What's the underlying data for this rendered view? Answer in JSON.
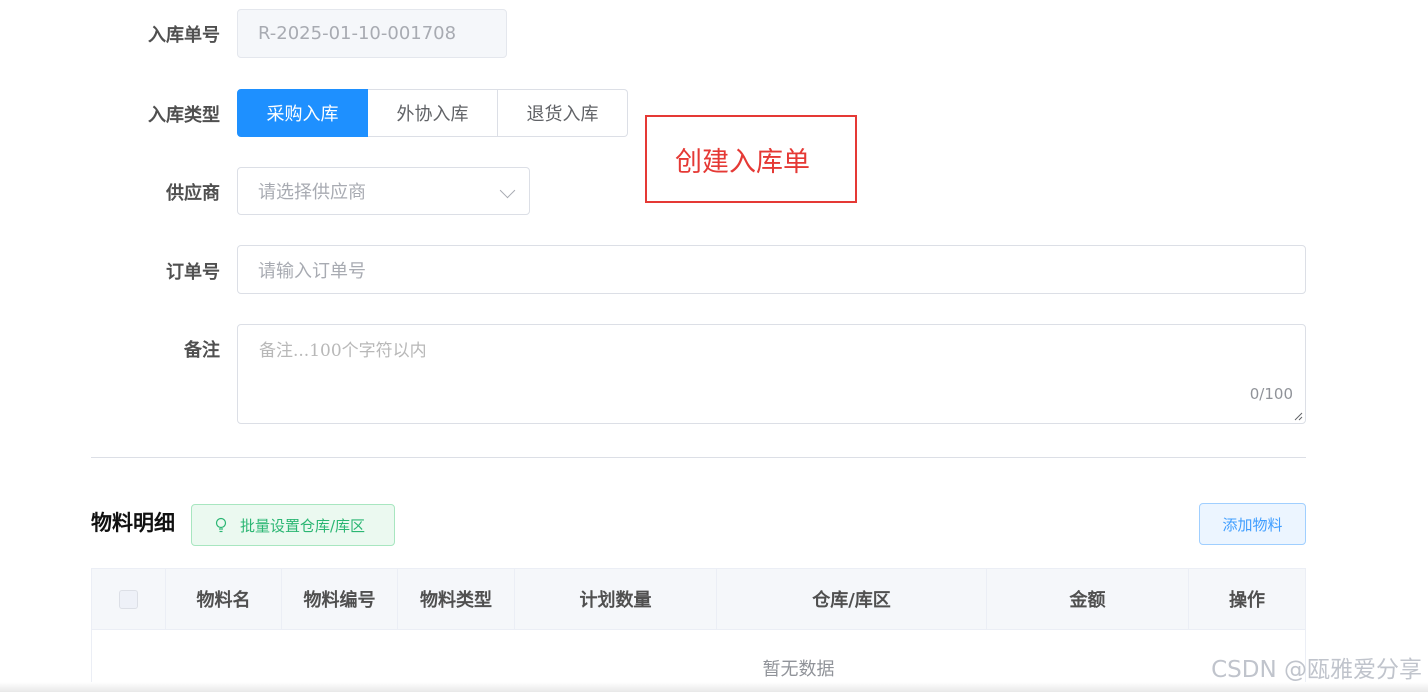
{
  "form": {
    "order_no": {
      "label": "入库单号",
      "value": "R-2025-01-10-001708"
    },
    "type": {
      "label": "入库类型",
      "options": [
        "采购入库",
        "外协入库",
        "退货入库"
      ],
      "selected": "采购入库"
    },
    "supplier": {
      "label": "供应商",
      "placeholder": "请选择供应商"
    },
    "purchase_order": {
      "label": "订单号",
      "placeholder": "请输入订单号"
    },
    "remark": {
      "label": "备注",
      "placeholder": "备注...100个字符以内",
      "count": "0/100"
    }
  },
  "annotation": {
    "text": "创建入库单",
    "color": "#e53935"
  },
  "materials": {
    "title": "物料明细",
    "batch_button": "批量设置仓库/库区",
    "add_button": "添加物料",
    "columns": [
      "物料名",
      "物料编号",
      "物料类型",
      "计划数量",
      "仓库/库区",
      "金额",
      "操作"
    ],
    "empty_text": "暂无数据"
  },
  "watermark": "CSDN @瓯雅爱分享",
  "colors": {
    "primary": "#1e90ff",
    "success": "#2bb673",
    "annotation": "#e53935"
  }
}
